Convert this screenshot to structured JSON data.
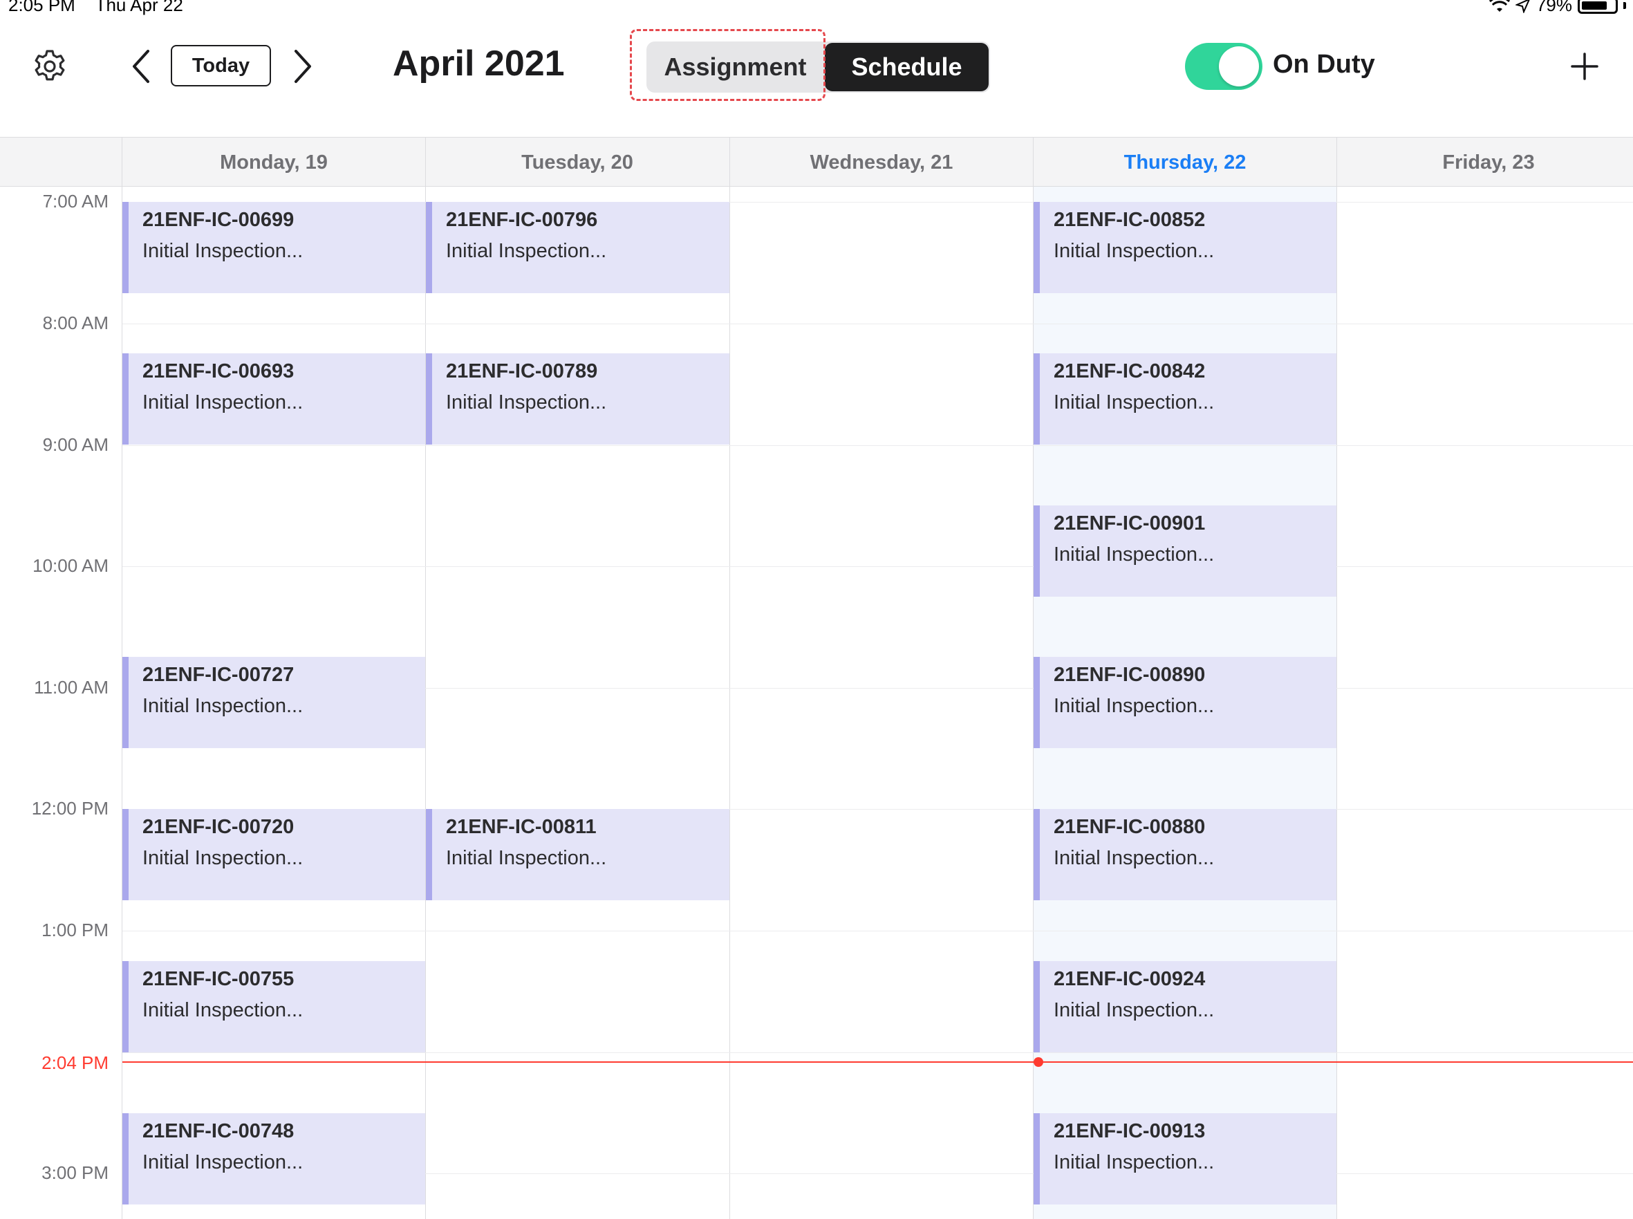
{
  "status_bar": {
    "time": "2:05 PM",
    "date": "Thu Apr 22",
    "battery": "79%"
  },
  "toolbar": {
    "today_label": "Today",
    "month_title": "April 2021",
    "segments": [
      "Assignment",
      "Schedule"
    ],
    "selected_segment": "Schedule",
    "duty_label": "On Duty",
    "duty_on": true,
    "accent_color": "#30d59a"
  },
  "days": [
    {
      "label": "Monday, 19",
      "today": false
    },
    {
      "label": "Tuesday, 20",
      "today": false
    },
    {
      "label": "Wednesday, 21",
      "today": false
    },
    {
      "label": "Thursday, 22",
      "today": true
    },
    {
      "label": "Friday, 23",
      "today": false
    }
  ],
  "time_labels": [
    "7:00 AM",
    "8:00 AM",
    "9:00 AM",
    "10:00 AM",
    "11:00 AM",
    "12:00 PM",
    "1:00 PM",
    "3:00 PM"
  ],
  "current_time_label": "2:04 PM",
  "events": {
    "monday": [
      {
        "id": "21ENF-IC-00699",
        "desc": "Initial Inspection..."
      },
      {
        "id": "21ENF-IC-00693",
        "desc": "Initial Inspection..."
      },
      {
        "id": "21ENF-IC-00727",
        "desc": "Initial Inspection..."
      },
      {
        "id": "21ENF-IC-00720",
        "desc": "Initial Inspection..."
      },
      {
        "id": "21ENF-IC-00755",
        "desc": "Initial Inspection..."
      },
      {
        "id": "21ENF-IC-00748",
        "desc": "Initial Inspection..."
      }
    ],
    "tuesday": [
      {
        "id": "21ENF-IC-00796",
        "desc": "Initial Inspection..."
      },
      {
        "id": "21ENF-IC-00789",
        "desc": "Initial Inspection..."
      },
      {
        "id": "21ENF-IC-00811",
        "desc": "Initial Inspection..."
      }
    ],
    "thursday": [
      {
        "id": "21ENF-IC-00852",
        "desc": "Initial Inspection..."
      },
      {
        "id": "21ENF-IC-00842",
        "desc": "Initial Inspection..."
      },
      {
        "id": "21ENF-IC-00901",
        "desc": "Initial Inspection..."
      },
      {
        "id": "21ENF-IC-00890",
        "desc": "Initial Inspection..."
      },
      {
        "id": "21ENF-IC-00880",
        "desc": "Initial Inspection..."
      },
      {
        "id": "21ENF-IC-00924",
        "desc": "Initial Inspection..."
      },
      {
        "id": "21ENF-IC-00913",
        "desc": "Initial Inspection..."
      }
    ]
  }
}
